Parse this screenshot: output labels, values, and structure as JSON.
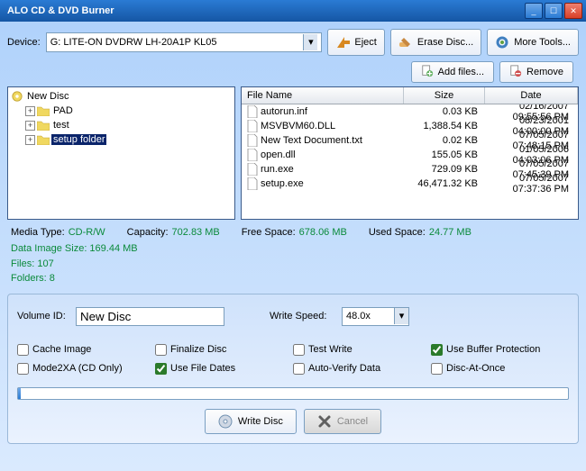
{
  "window": {
    "title": "ALO CD & DVD Burner"
  },
  "toolbar": {
    "device_label": "Device:",
    "device_value": "G: LITE-ON DVDRW LH-20A1P KL05",
    "eject": "Eject",
    "erase": "Erase Disc...",
    "more": "More Tools..."
  },
  "filebtns": {
    "add": "Add files...",
    "remove": "Remove"
  },
  "tree": {
    "root": "New Disc",
    "items": [
      {
        "label": "PAD"
      },
      {
        "label": "test"
      },
      {
        "label": "setup folder",
        "selected": true
      }
    ]
  },
  "cols": {
    "name": "File Name",
    "size": "Size",
    "date": "Date"
  },
  "files": [
    {
      "name": "autorun.inf",
      "size": "0.03 KB",
      "date": "02/16/2007 09:55:56 PM"
    },
    {
      "name": "MSVBVM60.DLL",
      "size": "1,388.54 KB",
      "date": "08/23/2001 04:00:00 PM"
    },
    {
      "name": "New Text Document.txt",
      "size": "0.02 KB",
      "date": "07/05/2007 07:48:15 PM"
    },
    {
      "name": "open.dll",
      "size": "155.05 KB",
      "date": "01/05/2006 04:03:06 PM"
    },
    {
      "name": "run.exe",
      "size": "729.09 KB",
      "date": "07/05/2007 07:45:39 PM"
    },
    {
      "name": "setup.exe",
      "size": "46,471.32 KB",
      "date": "07/05/2007 07:37:36 PM"
    }
  ],
  "stats": {
    "media_lbl": "Media Type:",
    "media_val": "CD-R/W",
    "cap_lbl": "Capacity:",
    "cap_val": "702.83 MB",
    "free_lbl": "Free Space:",
    "free_val": "678.06 MB",
    "used_lbl": "Used Space:",
    "used_val": "24.77 MB",
    "data_image": "Data Image Size: 169.44 MB",
    "files": "Files: 107",
    "folders": "Folders: 8"
  },
  "form": {
    "vol_lbl": "Volume ID:",
    "vol_val": "New Disc",
    "speed_lbl": "Write Speed:",
    "speed_val": "48.0x"
  },
  "checks": {
    "cache": "Cache Image",
    "finalize": "Finalize Disc",
    "test": "Test Write",
    "buffer": "Use Buffer Protection",
    "mode2xa": "Mode2XA (CD Only)",
    "filedates": "Use File Dates",
    "verify": "Auto-Verify Data",
    "dao": "Disc-At-Once"
  },
  "actions": {
    "write": "Write Disc",
    "cancel": "Cancel"
  }
}
